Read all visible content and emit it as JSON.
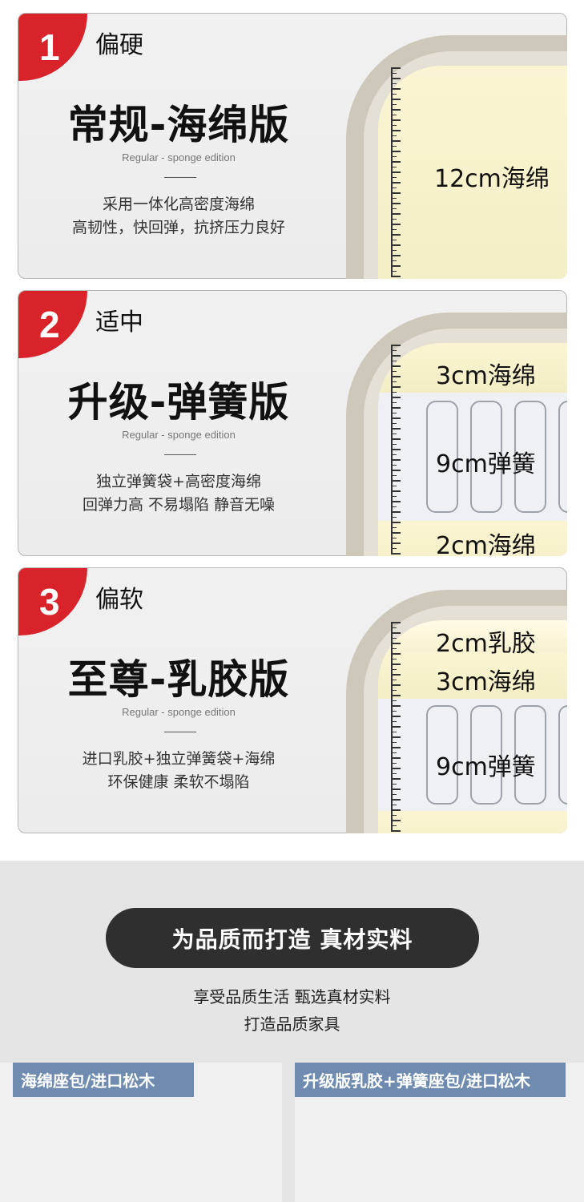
{
  "cards": [
    {
      "number": "1",
      "firmness": "偏硬",
      "title": "常规-海绵版",
      "subtitle": "Regular - sponge edition",
      "desc_line1": "采用一体化高密度海绵",
      "desc_line2": "高韧性，快回弹，抗挤压力良好",
      "layers": [
        "12cm海绵"
      ]
    },
    {
      "number": "2",
      "firmness": "适中",
      "title": "升级-弹簧版",
      "subtitle": "Regular - sponge edition",
      "desc_line1": "独立弹簧袋+高密度海绵",
      "desc_line2": "回弹力高 不易塌陷 静音无噪",
      "layers": [
        "3cm海绵",
        "9cm弹簧",
        "2cm海绵"
      ]
    },
    {
      "number": "3",
      "firmness": "偏软",
      "title": "至尊-乳胶版",
      "subtitle": "Regular - sponge edition",
      "desc_line1": "进口乳胶+独立弹簧袋+海绵",
      "desc_line2": "环保健康 柔软不塌陷",
      "layers": [
        "2cm乳胶",
        "3cm海绵",
        "9cm弹簧"
      ]
    }
  ],
  "quality": {
    "headline": "为品质而打造  真材实料",
    "line1": "享受品质生活 甄选真材实料",
    "line2": "打造品质家具"
  },
  "products": [
    {
      "label": "海绵座包/进口松木"
    },
    {
      "label": "升级版乳胶+弹簧座包/进口松木"
    }
  ],
  "colors": {
    "accent_red": "#d9232a",
    "tag_blue": "#6f8cb0",
    "pill_dark": "#2f2f2f"
  }
}
